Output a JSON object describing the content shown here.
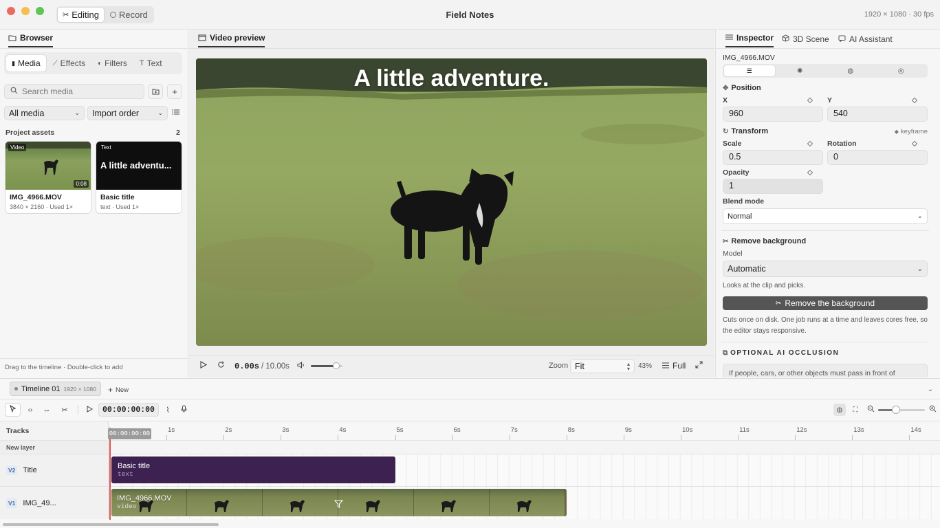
{
  "window": {
    "title": "Field Notes",
    "resolution_fps": "1920 × 1080 · 30 fps",
    "modes": [
      {
        "label": "Editing",
        "active": true
      },
      {
        "label": "Record",
        "active": false
      }
    ]
  },
  "browser": {
    "title": "Browser",
    "tabs": [
      {
        "label": "Media",
        "active": true
      },
      {
        "label": "Effects"
      },
      {
        "label": "Filters"
      },
      {
        "label": "Text"
      }
    ],
    "search": {
      "placeholder": "Search media",
      "value": ""
    },
    "filter_select": "All media",
    "sort_select": "Import order",
    "section_title": "Project assets",
    "asset_count": "2",
    "assets": [
      {
        "badge": "Video",
        "name": "IMG_4966.MOV",
        "meta": "3840 × 2160 · Used 1×",
        "duration": "0:08"
      },
      {
        "badge": "Text",
        "name": "Basic title",
        "meta": "text · Used 1×",
        "preview_text": "A little adventu..."
      }
    ],
    "footer_hint": "Drag to the timeline · Double-click to add"
  },
  "preview": {
    "tab_label": "Video preview",
    "overlay_text": "A little adventure.",
    "time_current": "0.00s",
    "time_total": "/ 10.00s",
    "volume_level": 0.8,
    "zoom_label": "Zoom",
    "zoom_value": "Fit",
    "zoom_percent": "43%",
    "full_label": "Full"
  },
  "inspector": {
    "tabs": [
      {
        "label": "Inspector",
        "active": true
      },
      {
        "label": "3D Scene"
      },
      {
        "label": "AI Assistant"
      }
    ],
    "clip_name": "IMG_4966.MOV",
    "position": {
      "title": "Position",
      "x_label": "X",
      "x_value": "960",
      "y_label": "Y",
      "y_value": "540"
    },
    "transform": {
      "title": "Transform",
      "keyframe_label": "keyframe",
      "scale_label": "Scale",
      "scale_value": "0.5",
      "rotation_label": "Rotation",
      "rotation_value": "0"
    },
    "opacity": {
      "label": "Opacity",
      "value": "1"
    },
    "blend": {
      "label": "Blend mode",
      "value": "Normal"
    },
    "remove_bg": {
      "title": "Remove background",
      "model_label": "Model",
      "model_value": "Automatic",
      "model_hint": "Looks at the clip and picks.",
      "button": "Remove the background",
      "description": "Cuts once on disk. One job runs at a time and leaves cores free, so the editor stays responsive."
    },
    "occlusion": {
      "title": "OPTIONAL AI OCCLUSION",
      "description": "If people, cars, or other objects must pass in front of"
    }
  },
  "timeline": {
    "tab_label": "Timeline 01",
    "tab_res": "1920 × 1080",
    "new_label": "New",
    "timecode": "00:00:00:00",
    "zoom_level": 0.38,
    "tracks_header": "Tracks",
    "new_layer": "New layer",
    "playhead_label": "00:00:00:00",
    "ruler": [
      "1s",
      "2s",
      "3s",
      "4s",
      "5s",
      "6s",
      "7s",
      "8s",
      "9s",
      "10s",
      "11s",
      "12s",
      "13s",
      "14s"
    ],
    "tracks": [
      {
        "tag": "V2",
        "name": "Title",
        "clip_name": "Basic title",
        "clip_type": "text"
      },
      {
        "tag": "V1",
        "name": "IMG_49...",
        "clip_name": "IMG_4966.MOV",
        "clip_type": "video"
      }
    ]
  },
  "colors": {
    "title_clip": "#3d2150",
    "video_clip": "#6e6548",
    "playhead": "#d9534f",
    "remove_button": "#555555"
  }
}
